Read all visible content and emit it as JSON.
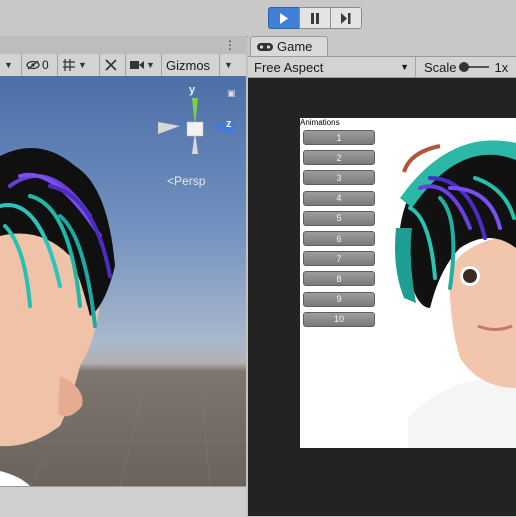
{
  "toolbar": {
    "play_icon": "play-icon",
    "pause_icon": "pause-icon",
    "step_icon": "step-icon",
    "accent": "#3f7fd6"
  },
  "scene": {
    "kebab": "⋮",
    "hidden_count": "0",
    "gizmos_label": "Gizmos",
    "axis_y": "y",
    "axis_z": "z",
    "persp_label": "Persp"
  },
  "game": {
    "tab_label": "Game",
    "aspect_label": "Free Aspect",
    "scale_label": "Scale",
    "scale_value": "1x",
    "animations_title": "Animations",
    "animation_buttons": [
      "1",
      "2",
      "3",
      "4",
      "5",
      "6",
      "7",
      "8",
      "9",
      "10"
    ]
  }
}
